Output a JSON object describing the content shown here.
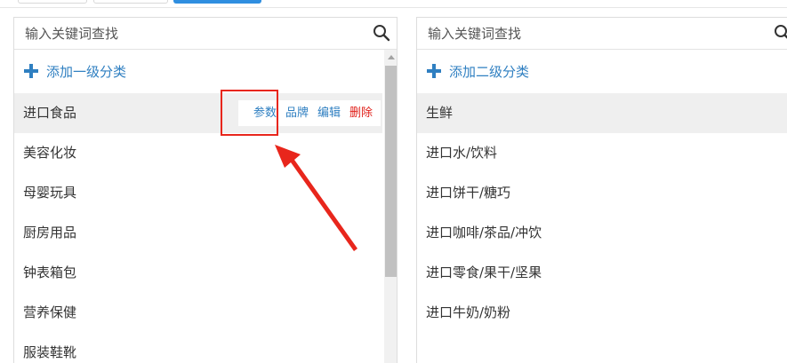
{
  "left_panel": {
    "search_placeholder": "输入关键词查找",
    "add_label": "添加一级分类",
    "items": [
      {
        "label": "进口食品"
      },
      {
        "label": "美容化妆"
      },
      {
        "label": "母婴玩具"
      },
      {
        "label": "厨房用品"
      },
      {
        "label": "钟表箱包"
      },
      {
        "label": "营养保健"
      },
      {
        "label": "服装鞋靴"
      }
    ],
    "actions": {
      "params": "参数",
      "brand": "品牌",
      "edit": "编辑",
      "delete": "删除"
    }
  },
  "right_panel": {
    "search_placeholder": "输入关键词查找",
    "add_label": "添加二级分类",
    "items": [
      {
        "label": "生鲜"
      },
      {
        "label": "进口水/饮料"
      },
      {
        "label": "进口饼干/糖巧"
      },
      {
        "label": "进口咖啡/茶品/冲饮"
      },
      {
        "label": "进口零食/果干/坚果"
      },
      {
        "label": "进口牛奶/奶粉"
      }
    ]
  },
  "colors": {
    "accent": "#2f7fc1",
    "danger": "#e0201a",
    "annotation": "#e8261c",
    "active_row": "#efefef"
  },
  "icons": {
    "search": "search-icon",
    "add": "plus-icon"
  }
}
